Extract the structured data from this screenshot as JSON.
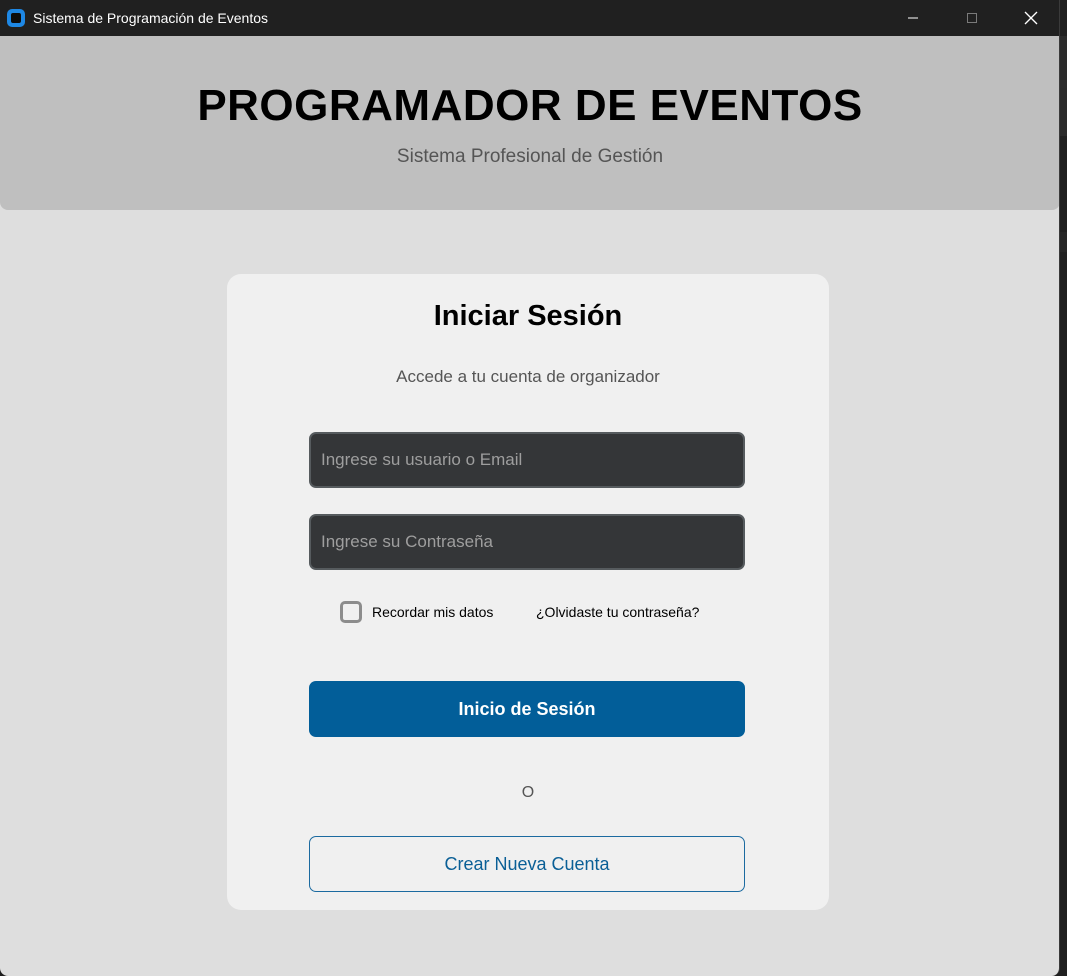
{
  "window": {
    "title": "Sistema de Programación de Eventos",
    "controls": {
      "minimize_icon": "minimize-icon",
      "maximize_icon": "maximize-icon",
      "close_icon": "close-icon"
    }
  },
  "header": {
    "title": "PROGRAMADOR DE EVENTOS",
    "subtitle": "Sistema Profesional de Gestión"
  },
  "login": {
    "title": "Iniciar Sesión",
    "subtitle": "Accede a tu cuenta de organizador",
    "username": {
      "value": "",
      "placeholder": "Ingrese su usuario o Email"
    },
    "password": {
      "value": "",
      "placeholder": "Ingrese su Contraseña"
    },
    "remember_label": "Recordar mis datos",
    "remember_checked": false,
    "forgot_link": "¿Olvidaste tu contraseña?",
    "login_button": "Inicio de Sesión",
    "separator": "O",
    "create_button": "Crear Nueva Cuenta"
  },
  "colors": {
    "primary_button": "#025e99",
    "header_band": "#bfbfbf",
    "page_background": "#dedede",
    "card_background": "#f0f0f0",
    "input_background": "#343638"
  }
}
